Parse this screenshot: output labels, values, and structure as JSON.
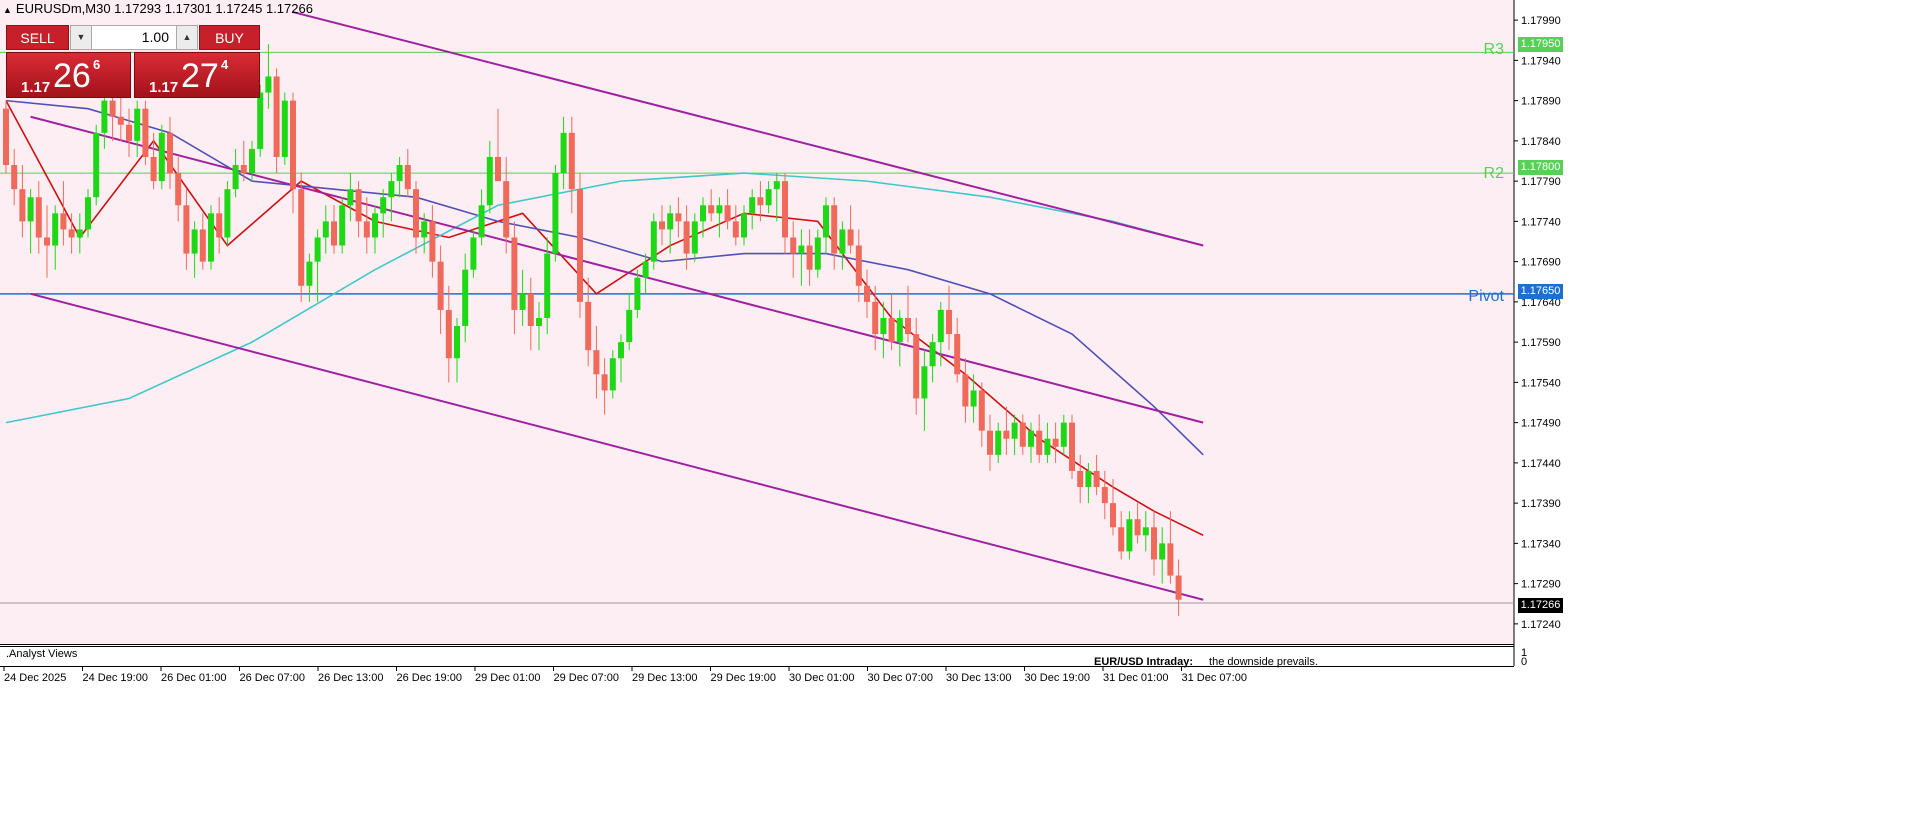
{
  "symbol_line": "EURUSDm,M30  1.17293 1.17301 1.17245 1.17266",
  "trade_panel": {
    "sell_label": "SELL",
    "buy_label": "BUY",
    "lot_value": "1.00",
    "sell_prefix": "1.17",
    "sell_big": "26",
    "sell_sup": "6",
    "buy_prefix": "1.17",
    "buy_big": "27",
    "buy_sup": "4"
  },
  "levels": {
    "r3_label": "R3",
    "r3_price": "1.17950",
    "r2_label": "R2",
    "r2_price": "1.17800",
    "pivot_label": "Pivot",
    "pivot_price": "1.17650",
    "current_price": "1.17266"
  },
  "colors": {
    "background": "#fdeef4",
    "bull": "#1ed816",
    "bear": "#ef6a5a",
    "resistance": "#58d058",
    "pivot": "#1f6fd0",
    "channel": "#a020a0",
    "ma_fast": "#d01010",
    "ma_mid": "#5050b8",
    "ma_slow": "#40c8c8"
  },
  "indicator_panel": {
    "title": ".Analyst Views",
    "y_labels": [
      "1",
      "0"
    ],
    "caption_title": "EUR/USD Intraday:",
    "caption_text": "the downside prevails."
  },
  "chart_data": {
    "type": "candlestick",
    "symbol": "EURUSDm",
    "timeframe": "M30",
    "ylim": [
      1.17215,
      1.18015
    ],
    "y_ticks": [
      "1.17990",
      "1.17940",
      "1.17890",
      "1.17840",
      "1.17790",
      "1.17740",
      "1.17690",
      "1.17640",
      "1.17590",
      "1.17540",
      "1.17490",
      "1.17440",
      "1.17390",
      "1.17340",
      "1.17290",
      "1.17240"
    ],
    "x_ticks": [
      "24 Dec 2025",
      "24 Dec 19:00",
      "26 Dec 01:00",
      "26 Dec 07:00",
      "26 Dec 13:00",
      "26 Dec 19:00",
      "29 Dec 01:00",
      "29 Dec 07:00",
      "29 Dec 13:00",
      "29 Dec 19:00",
      "30 Dec 01:00",
      "30 Dec 07:00",
      "30 Dec 13:00",
      "30 Dec 19:00",
      "31 Dec 01:00",
      "31 Dec 07:00"
    ],
    "horizontal_levels": [
      {
        "name": "R3",
        "value": 1.1795
      },
      {
        "name": "R2",
        "value": 1.178
      },
      {
        "name": "Pivot",
        "value": 1.1765
      },
      {
        "name": "current",
        "value": 1.17266
      }
    ],
    "candles": [
      [
        1.1788,
        1.1789,
        1.178,
        1.1781
      ],
      [
        1.1781,
        1.1783,
        1.1776,
        1.1778
      ],
      [
        1.1778,
        1.1781,
        1.1772,
        1.1774
      ],
      [
        1.1774,
        1.1778,
        1.177,
        1.1777
      ],
      [
        1.1777,
        1.1779,
        1.177,
        1.1772
      ],
      [
        1.1772,
        1.1776,
        1.1767,
        1.1771
      ],
      [
        1.1771,
        1.1776,
        1.1768,
        1.1775
      ],
      [
        1.1775,
        1.1779,
        1.1771,
        1.1773
      ],
      [
        1.1773,
        1.1775,
        1.177,
        1.1772
      ],
      [
        1.1772,
        1.1775,
        1.177,
        1.1773
      ],
      [
        1.1773,
        1.1778,
        1.1772,
        1.1777
      ],
      [
        1.1777,
        1.1786,
        1.1776,
        1.1785
      ],
      [
        1.1785,
        1.179,
        1.1783,
        1.1789
      ],
      [
        1.1789,
        1.179,
        1.1784,
        1.1787
      ],
      [
        1.1787,
        1.179,
        1.1784,
        1.1786
      ],
      [
        1.1786,
        1.1788,
        1.1782,
        1.1784
      ],
      [
        1.1784,
        1.1789,
        1.1782,
        1.1788
      ],
      [
        1.1788,
        1.1789,
        1.1781,
        1.1782
      ],
      [
        1.1782,
        1.1785,
        1.1778,
        1.1779
      ],
      [
        1.1779,
        1.1786,
        1.1778,
        1.1785
      ],
      [
        1.1785,
        1.1787,
        1.1778,
        1.178
      ],
      [
        1.178,
        1.1782,
        1.1774,
        1.1776
      ],
      [
        1.1776,
        1.1778,
        1.1768,
        1.177
      ],
      [
        1.177,
        1.1774,
        1.1767,
        1.1773
      ],
      [
        1.1773,
        1.1775,
        1.1768,
        1.1769
      ],
      [
        1.1769,
        1.1776,
        1.1768,
        1.1775
      ],
      [
        1.1775,
        1.1777,
        1.177,
        1.1772
      ],
      [
        1.1772,
        1.1779,
        1.1771,
        1.1778
      ],
      [
        1.1778,
        1.1783,
        1.1777,
        1.1781
      ],
      [
        1.1781,
        1.1784,
        1.1779,
        1.178
      ],
      [
        1.178,
        1.1784,
        1.1779,
        1.1783
      ],
      [
        1.1783,
        1.1791,
        1.1782,
        1.179
      ],
      [
        1.179,
        1.1796,
        1.1788,
        1.1792
      ],
      [
        1.1792,
        1.1793,
        1.178,
        1.1782
      ],
      [
        1.1782,
        1.179,
        1.1781,
        1.1789
      ],
      [
        1.1789,
        1.179,
        1.1775,
        1.1778
      ],
      [
        1.1778,
        1.178,
        1.1764,
        1.1766
      ],
      [
        1.1766,
        1.177,
        1.1764,
        1.1769
      ],
      [
        1.1769,
        1.1773,
        1.1764,
        1.1772
      ],
      [
        1.1772,
        1.1776,
        1.177,
        1.1774
      ],
      [
        1.1774,
        1.1776,
        1.177,
        1.1771
      ],
      [
        1.1771,
        1.1777,
        1.177,
        1.1776
      ],
      [
        1.1776,
        1.178,
        1.1774,
        1.1778
      ],
      [
        1.1778,
        1.1779,
        1.1772,
        1.1774
      ],
      [
        1.1774,
        1.1777,
        1.177,
        1.1772
      ],
      [
        1.1772,
        1.1776,
        1.177,
        1.1775
      ],
      [
        1.1775,
        1.1778,
        1.1772,
        1.1777
      ],
      [
        1.1777,
        1.178,
        1.1774,
        1.1779
      ],
      [
        1.1779,
        1.1782,
        1.1777,
        1.1781
      ],
      [
        1.1781,
        1.1783,
        1.1777,
        1.1778
      ],
      [
        1.1778,
        1.1779,
        1.177,
        1.1772
      ],
      [
        1.1772,
        1.1775,
        1.177,
        1.1774
      ],
      [
        1.1774,
        1.1776,
        1.1767,
        1.1769
      ],
      [
        1.1769,
        1.1771,
        1.176,
        1.1763
      ],
      [
        1.1763,
        1.1766,
        1.1754,
        1.1757
      ],
      [
        1.1757,
        1.1762,
        1.1754,
        1.1761
      ],
      [
        1.1761,
        1.177,
        1.1759,
        1.1768
      ],
      [
        1.1768,
        1.1773,
        1.1767,
        1.1772
      ],
      [
        1.1772,
        1.1778,
        1.1771,
        1.1776
      ],
      [
        1.1776,
        1.1784,
        1.1775,
        1.1782
      ],
      [
        1.1782,
        1.1788,
        1.178,
        1.1779
      ],
      [
        1.1779,
        1.1782,
        1.177,
        1.1772
      ],
      [
        1.1772,
        1.1774,
        1.176,
        1.1763
      ],
      [
        1.1763,
        1.1768,
        1.1761,
        1.1765
      ],
      [
        1.1765,
        1.1767,
        1.1758,
        1.1761
      ],
      [
        1.1761,
        1.1764,
        1.1758,
        1.1762
      ],
      [
        1.1762,
        1.1772,
        1.176,
        1.177
      ],
      [
        1.177,
        1.1781,
        1.1769,
        1.178
      ],
      [
        1.178,
        1.1787,
        1.1778,
        1.1785
      ],
      [
        1.1785,
        1.1787,
        1.1775,
        1.1778
      ],
      [
        1.1778,
        1.178,
        1.1762,
        1.1764
      ],
      [
        1.1764,
        1.1767,
        1.1756,
        1.1758
      ],
      [
        1.1758,
        1.1761,
        1.1752,
        1.1755
      ],
      [
        1.1755,
        1.1757,
        1.175,
        1.1753
      ],
      [
        1.1753,
        1.1758,
        1.1752,
        1.1757
      ],
      [
        1.1757,
        1.176,
        1.1754,
        1.1759
      ],
      [
        1.1759,
        1.1765,
        1.1758,
        1.1763
      ],
      [
        1.1763,
        1.1768,
        1.1762,
        1.1767
      ],
      [
        1.1767,
        1.177,
        1.1765,
        1.1769
      ],
      [
        1.1769,
        1.1775,
        1.1768,
        1.1774
      ],
      [
        1.1774,
        1.1776,
        1.1771,
        1.1773
      ],
      [
        1.1773,
        1.1776,
        1.177,
        1.1775
      ],
      [
        1.1775,
        1.1777,
        1.1772,
        1.1774
      ],
      [
        1.1774,
        1.1776,
        1.1768,
        1.177
      ],
      [
        1.177,
        1.1775,
        1.1769,
        1.1774
      ],
      [
        1.1774,
        1.1777,
        1.1772,
        1.1776
      ],
      [
        1.1776,
        1.1778,
        1.1774,
        1.1775
      ],
      [
        1.1775,
        1.1777,
        1.1772,
        1.1776
      ],
      [
        1.1776,
        1.1778,
        1.1773,
        1.1774
      ],
      [
        1.1774,
        1.1776,
        1.1771,
        1.1772
      ],
      [
        1.1772,
        1.1776,
        1.1771,
        1.1775
      ],
      [
        1.1775,
        1.1778,
        1.1773,
        1.1777
      ],
      [
        1.1777,
        1.1779,
        1.1774,
        1.1776
      ],
      [
        1.1776,
        1.1779,
        1.1775,
        1.1778
      ],
      [
        1.1778,
        1.178,
        1.1774,
        1.1779
      ],
      [
        1.1779,
        1.178,
        1.177,
        1.1772
      ],
      [
        1.1772,
        1.1774,
        1.1767,
        1.177
      ],
      [
        1.177,
        1.1773,
        1.1766,
        1.1771
      ],
      [
        1.1771,
        1.1773,
        1.1766,
        1.1768
      ],
      [
        1.1768,
        1.1773,
        1.1767,
        1.1772
      ],
      [
        1.1772,
        1.1777,
        1.177,
        1.1776
      ],
      [
        1.1776,
        1.1777,
        1.1768,
        1.177
      ],
      [
        1.177,
        1.1774,
        1.1768,
        1.1773
      ],
      [
        1.1773,
        1.1776,
        1.177,
        1.1771
      ],
      [
        1.1771,
        1.1773,
        1.1764,
        1.1766
      ],
      [
        1.1766,
        1.1768,
        1.1762,
        1.1764
      ],
      [
        1.1764,
        1.1766,
        1.1758,
        1.176
      ],
      [
        1.176,
        1.1764,
        1.1757,
        1.1762
      ],
      [
        1.1762,
        1.1765,
        1.1758,
        1.1759
      ],
      [
        1.1759,
        1.1763,
        1.1756,
        1.1762
      ],
      [
        1.1762,
        1.1766,
        1.1759,
        1.176
      ],
      [
        1.176,
        1.1762,
        1.175,
        1.1752
      ],
      [
        1.1752,
        1.1758,
        1.1748,
        1.1756
      ],
      [
        1.1756,
        1.176,
        1.1754,
        1.1759
      ],
      [
        1.1759,
        1.1764,
        1.1756,
        1.1763
      ],
      [
        1.1763,
        1.1766,
        1.1758,
        1.176
      ],
      [
        1.176,
        1.1762,
        1.1754,
        1.1755
      ],
      [
        1.1755,
        1.1757,
        1.1749,
        1.1751
      ],
      [
        1.1751,
        1.1755,
        1.1749,
        1.1753
      ],
      [
        1.1753,
        1.1754,
        1.1746,
        1.1748
      ],
      [
        1.1748,
        1.175,
        1.1743,
        1.1745
      ],
      [
        1.1745,
        1.1749,
        1.1744,
        1.1748
      ],
      [
        1.1748,
        1.1751,
        1.1745,
        1.1747
      ],
      [
        1.1747,
        1.175,
        1.1745,
        1.1749
      ],
      [
        1.1749,
        1.175,
        1.1745,
        1.1746
      ],
      [
        1.1746,
        1.1749,
        1.1744,
        1.1748
      ],
      [
        1.1748,
        1.175,
        1.1744,
        1.1745
      ],
      [
        1.1745,
        1.1749,
        1.1744,
        1.1747
      ],
      [
        1.1747,
        1.1749,
        1.1744,
        1.1746
      ],
      [
        1.1746,
        1.175,
        1.1745,
        1.1749
      ],
      [
        1.1749,
        1.175,
        1.1742,
        1.1743
      ],
      [
        1.1743,
        1.1745,
        1.1739,
        1.1741
      ],
      [
        1.1741,
        1.1744,
        1.1739,
        1.1743
      ],
      [
        1.1743,
        1.1745,
        1.174,
        1.1741
      ],
      [
        1.1741,
        1.1743,
        1.1737,
        1.1739
      ],
      [
        1.1739,
        1.1742,
        1.1735,
        1.1736
      ],
      [
        1.1736,
        1.1738,
        1.1732,
        1.1733
      ],
      [
        1.1733,
        1.1738,
        1.1732,
        1.1737
      ],
      [
        1.1737,
        1.1739,
        1.1734,
        1.1735
      ],
      [
        1.1735,
        1.1738,
        1.1733,
        1.1736
      ],
      [
        1.1736,
        1.1738,
        1.173,
        1.1732
      ],
      [
        1.1732,
        1.1736,
        1.1729,
        1.1734
      ],
      [
        1.1734,
        1.1738,
        1.1729,
        1.173
      ],
      [
        1.173,
        1.1732,
        1.1725,
        1.1727
      ]
    ],
    "moving_averages": [
      {
        "x": [
          0,
          9,
          18,
          27,
          36,
          45,
          54,
          63,
          72,
          81,
          90,
          99,
          108,
          117,
          126,
          135,
          140,
          146
        ],
        "y": [
          1.1789,
          1.1772,
          1.1784,
          1.1771,
          1.1779,
          1.1774,
          1.1772,
          1.1775,
          1.1765,
          1.1771,
          1.1775,
          1.1774,
          1.1762,
          1.1755,
          1.1747,
          1.1741,
          1.1738,
          1.1735
        ]
      },
      {
        "x": [
          0,
          10,
          20,
          30,
          40,
          50,
          60,
          70,
          80,
          90,
          100,
          110,
          120,
          130,
          140,
          146
        ],
        "y": [
          1.1789,
          1.1788,
          1.1785,
          1.1779,
          1.1778,
          1.1777,
          1.1774,
          1.1772,
          1.1769,
          1.177,
          1.177,
          1.1768,
          1.1765,
          1.176,
          1.1751,
          1.1745
        ]
      },
      {
        "x": [
          0,
          15,
          30,
          45,
          60,
          75,
          90,
          105,
          120,
          135,
          146
        ],
        "y": [
          1.1749,
          1.1752,
          1.1759,
          1.1768,
          1.1776,
          1.1779,
          1.178,
          1.1779,
          1.1777,
          1.1774,
          1.1771
        ]
      }
    ],
    "channel_lines": [
      {
        "x1": 35,
        "y1": 1.18,
        "x2": 146,
        "y2": 1.1771
      },
      {
        "x1": 3,
        "y1": 1.1787,
        "x2": 146,
        "y2": 1.1749
      },
      {
        "x1": 3,
        "y1": 1.1765,
        "x2": 146,
        "y2": 1.1727
      }
    ]
  }
}
